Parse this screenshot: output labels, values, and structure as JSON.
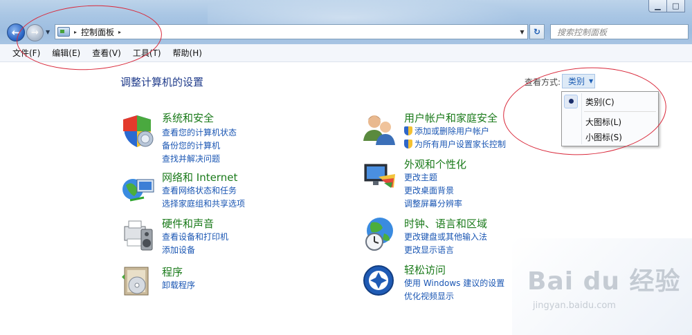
{
  "window": {
    "minimize_glyph": "▁",
    "maximize_glyph": "□"
  },
  "navigation": {
    "back_glyph": "←",
    "forward_glyph": "→",
    "dropdown_glyph": "▼"
  },
  "address": {
    "crumbs": [
      "控制面板"
    ],
    "separator_glyph": "▸",
    "dropdown_glyph": "▼",
    "refresh_glyph": "↻"
  },
  "search": {
    "placeholder": "搜索控制面板"
  },
  "menubar": {
    "items": [
      "文件(F)",
      "编辑(E)",
      "查看(V)",
      "工具(T)",
      "帮助(H)"
    ]
  },
  "main": {
    "title": "调整计算机的设置",
    "view_by_label": "查看方式:",
    "view_by_value": "类别",
    "view_by_caret": "▼"
  },
  "view_menu": {
    "items": [
      "类别(C)",
      "大图标(L)",
      "小图标(S)"
    ],
    "selected": "类别(C)"
  },
  "categories_left": [
    {
      "title": "系统和安全",
      "icon": "shield-security-icon",
      "links": [
        "查看您的计算机状态",
        "备份您的计算机",
        "查找并解决问题"
      ]
    },
    {
      "title": "网络和 Internet",
      "icon": "network-globe-icon",
      "links": [
        "查看网络状态和任务",
        "选择家庭组和共享选项"
      ]
    },
    {
      "title": "硬件和声音",
      "icon": "printer-speaker-icon",
      "links": [
        "查看设备和打印机",
        "添加设备"
      ]
    },
    {
      "title": "程序",
      "icon": "programs-disc-icon",
      "links": [
        "卸载程序"
      ]
    }
  ],
  "categories_right": [
    {
      "title": "用户帐户和家庭安全",
      "icon": "users-icon",
      "links": [
        "添加或删除用户帐户",
        "为所有用户设置家长控制"
      ],
      "shielded_links": true
    },
    {
      "title": "外观和个性化",
      "icon": "monitor-palette-icon",
      "links": [
        "更改主题",
        "更改桌面背景",
        "调整屏幕分辨率"
      ]
    },
    {
      "title": "时钟、语言和区域",
      "icon": "globe-clock-icon",
      "links": [
        "更改键盘或其他输入法",
        "更改显示语言"
      ]
    },
    {
      "title": "轻松访问",
      "icon": "ease-of-access-icon",
      "links": [
        "使用 Windows 建议的设置",
        "优化视频显示"
      ]
    }
  ],
  "watermark": {
    "logo": "Bai du 经验",
    "url": "jingyan.baidu.com"
  },
  "colors": {
    "category_title": "#1a7a1a",
    "link": "#1a56b3",
    "page_title": "#1e3a8a",
    "annotation": "#d9283a"
  }
}
